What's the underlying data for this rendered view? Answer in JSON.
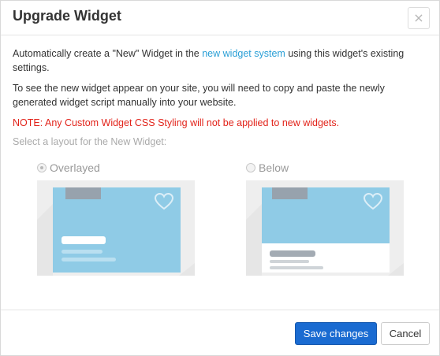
{
  "dialog": {
    "title": "Upgrade Widget",
    "close_glyph": "×"
  },
  "body": {
    "intro_before_link": "Automatically create a \"New\" Widget in the ",
    "intro_link": "new widget system",
    "intro_after_link": " using this widget's existing settings.",
    "instructions": "To see the new widget appear on your site, you will need to copy and paste the newly generated widget script manually into your website.",
    "note": "NOTE: Any Custom Widget CSS Styling will not be applied to new widgets.",
    "select_prompt": "Select a layout for the New Widget:"
  },
  "layouts": [
    {
      "label": "Overlayed",
      "selected": true
    },
    {
      "label": "Below",
      "selected": false
    }
  ],
  "footer": {
    "save_label": "Save changes",
    "cancel_label": "Cancel"
  },
  "colors": {
    "link": "#2a9fd6",
    "note": "#e2231a",
    "primary_button": "#1a6bd1",
    "preview_blue": "#8fcbe6",
    "preview_tag": "#97a2ad"
  },
  "icons": {
    "close": "close-icon",
    "favorite": "heart-icon"
  }
}
